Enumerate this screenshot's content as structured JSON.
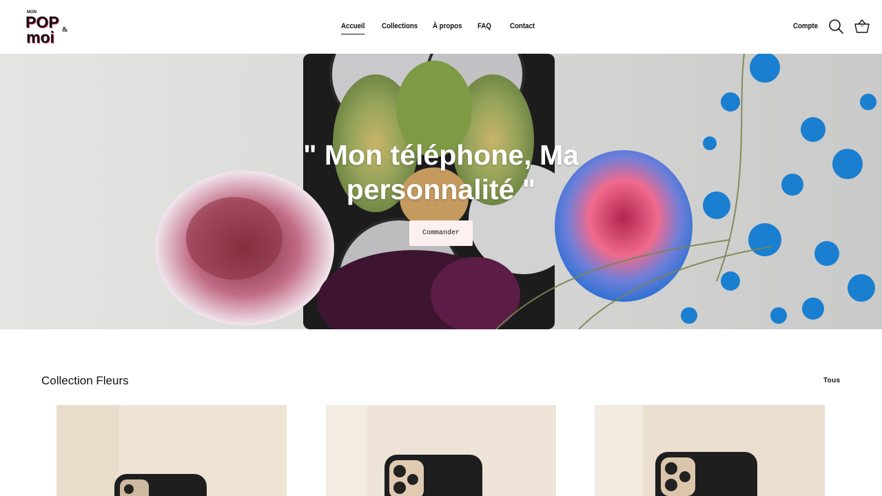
{
  "brand": {
    "logo_small": "MON",
    "logo_main_1": "POP",
    "logo_amp": "&",
    "logo_main_2": "moi"
  },
  "nav": {
    "items": [
      {
        "label": "Accueil",
        "active": true
      },
      {
        "label": "Collections",
        "active": false
      },
      {
        "label": "À propos",
        "active": false
      },
      {
        "label": "FAQ",
        "active": false
      },
      {
        "label": "Contact",
        "active": false
      }
    ]
  },
  "header": {
    "account_label": "Compte",
    "cart_count": "0",
    "search_icon": "search-icon",
    "cart_icon": "basket-icon"
  },
  "hero": {
    "title": "\" Mon téléphone, Ma personnalité \"",
    "cta_label": "Commander"
  },
  "collection": {
    "title": "Collection Fleurs",
    "view_all_label": "Tous"
  },
  "colors": {
    "cta_background": "#fdf1ef",
    "text": "#111111",
    "header_background": "#ffffff"
  }
}
